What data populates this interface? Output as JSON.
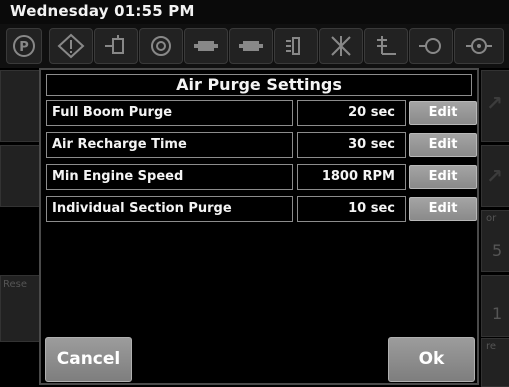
{
  "status_bar": {
    "clock": "Wednesday 01:55 PM"
  },
  "icon_bar": {
    "icons": [
      "parking-icon",
      "warning-icon",
      "boom-valve-icon",
      "engine-icon",
      "section-on-icon",
      "section-off-icon",
      "nozzle-spray-icon",
      "nozzle-off-icon",
      "boom-height-icon",
      "pump-icon",
      "flow-meter-icon"
    ]
  },
  "background": {
    "left_labels": [
      "Rese"
    ],
    "right_labels": [
      "or",
      "5",
      "1",
      "re"
    ]
  },
  "dialog": {
    "title": "Air Purge Settings",
    "rows": [
      {
        "label": "Full Boom Purge",
        "value": "20 sec",
        "button": "Edit"
      },
      {
        "label": "Air Recharge Time",
        "value": "30 sec",
        "button": "Edit"
      },
      {
        "label": "Min Engine Speed",
        "value": "1800 RPM",
        "button": "Edit"
      },
      {
        "label": "Individual Section Purge",
        "value": "10 sec",
        "button": "Edit"
      }
    ],
    "cancel_label": "Cancel",
    "ok_label": "Ok"
  },
  "colors": {
    "dialog_bg": "#000000",
    "button_gray": "#8a8a8a",
    "border_gray": "#8c8c8c"
  }
}
